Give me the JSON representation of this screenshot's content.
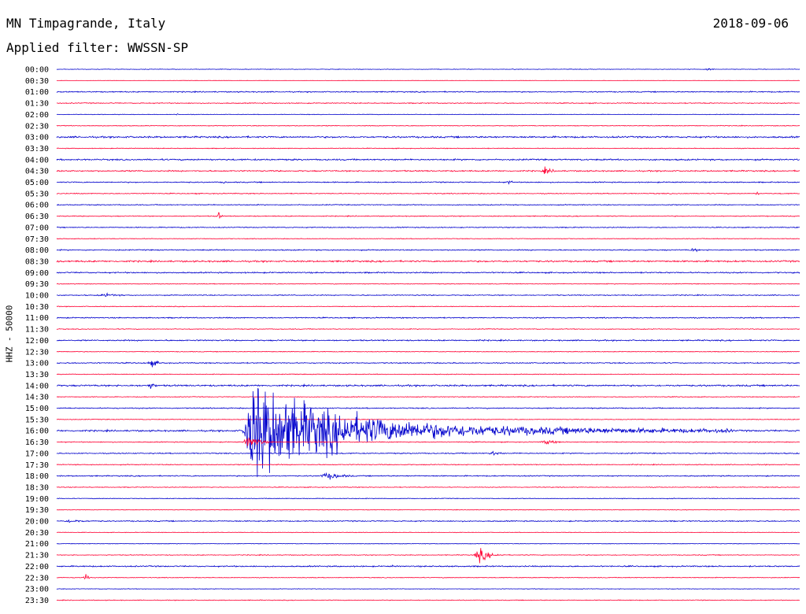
{
  "header": {
    "title": "MN Timpagrande, Italy",
    "date": "2018-09-06",
    "filter": "Applied filter: WWSSN-SP"
  },
  "chart_data": {
    "type": "line",
    "ylabel": "HHZ - 50000",
    "colors": {
      "even": "#0000cc",
      "odd": "#ff0033"
    },
    "rows": [
      "00:00",
      "00:30",
      "01:00",
      "01:30",
      "02:00",
      "02:30",
      "03:00",
      "03:30",
      "04:00",
      "04:30",
      "05:00",
      "05:30",
      "06:00",
      "06:30",
      "07:00",
      "07:30",
      "08:00",
      "08:30",
      "09:00",
      "09:30",
      "10:00",
      "10:30",
      "11:00",
      "11:30",
      "12:00",
      "12:30",
      "13:00",
      "13:30",
      "14:00",
      "14:30",
      "15:00",
      "15:30",
      "16:00",
      "16:30",
      "17:00",
      "17:30",
      "18:00",
      "18:30",
      "19:00",
      "19:30",
      "20:00",
      "20:30",
      "21:00",
      "21:30",
      "22:00",
      "22:30",
      "23:00",
      "23:30"
    ],
    "noise": [
      0.3,
      0.2,
      0.6,
      0.5,
      0.3,
      0.4,
      0.9,
      0.4,
      0.8,
      0.7,
      0.6,
      0.5,
      0.5,
      0.5,
      0.5,
      0.4,
      0.6,
      0.9,
      0.7,
      0.4,
      0.5,
      0.4,
      0.6,
      0.4,
      0.7,
      0.4,
      0.6,
      0.4,
      0.9,
      0.4,
      0.6,
      0.4,
      0.9,
      0.5,
      0.6,
      0.5,
      0.6,
      0.4,
      0.4,
      0.3,
      0.6,
      0.3,
      0.3,
      0.4,
      0.7,
      0.4,
      0.3,
      0.4
    ],
    "events": [
      {
        "row": 0,
        "t": 0.87,
        "amp": 1.5,
        "dur": 0.03
      },
      {
        "row": 4,
        "t": 0.16,
        "amp": 3,
        "dur": 0.008
      },
      {
        "row": 9,
        "t": 0.65,
        "amp": 4,
        "dur": 0.04
      },
      {
        "row": 10,
        "t": 0.22,
        "amp": 2,
        "dur": 0.02
      },
      {
        "row": 10,
        "t": 0.6,
        "amp": 2,
        "dur": 0.04
      },
      {
        "row": 11,
        "t": 0.94,
        "amp": 3,
        "dur": 0.01
      },
      {
        "row": 13,
        "t": 0.215,
        "amp": 6,
        "dur": 0.012
      },
      {
        "row": 14,
        "t": 0.39,
        "amp": 2,
        "dur": 0.015
      },
      {
        "row": 16,
        "t": 0.85,
        "amp": 2.5,
        "dur": 0.03
      },
      {
        "row": 20,
        "t": 0.05,
        "amp": 2,
        "dur": 0.08
      },
      {
        "row": 26,
        "t": 0.12,
        "amp": 4,
        "dur": 0.04
      },
      {
        "row": 28,
        "t": 0.12,
        "amp": 4,
        "dur": 0.03
      },
      {
        "row": 32,
        "t": 0.25,
        "amp": 60,
        "dur": 0.66
      },
      {
        "row": 33,
        "t": 0.25,
        "amp": 8,
        "dur": 0.05
      },
      {
        "row": 33,
        "t": 0.65,
        "amp": 3,
        "dur": 0.05
      },
      {
        "row": 34,
        "t": 0.58,
        "amp": 3,
        "dur": 0.04
      },
      {
        "row": 36,
        "t": 0.35,
        "amp": 4,
        "dur": 0.08
      },
      {
        "row": 39,
        "t": 0.32,
        "amp": 2,
        "dur": 0.01
      },
      {
        "row": 40,
        "t": 0.0,
        "amp": 2,
        "dur": 0.1
      },
      {
        "row": 43,
        "t": 0.56,
        "amp": 8,
        "dur": 0.05
      },
      {
        "row": 44,
        "t": 0.45,
        "amp": 2,
        "dur": 0.008
      },
      {
        "row": 45,
        "t": 0.035,
        "amp": 6,
        "dur": 0.015
      }
    ]
  }
}
